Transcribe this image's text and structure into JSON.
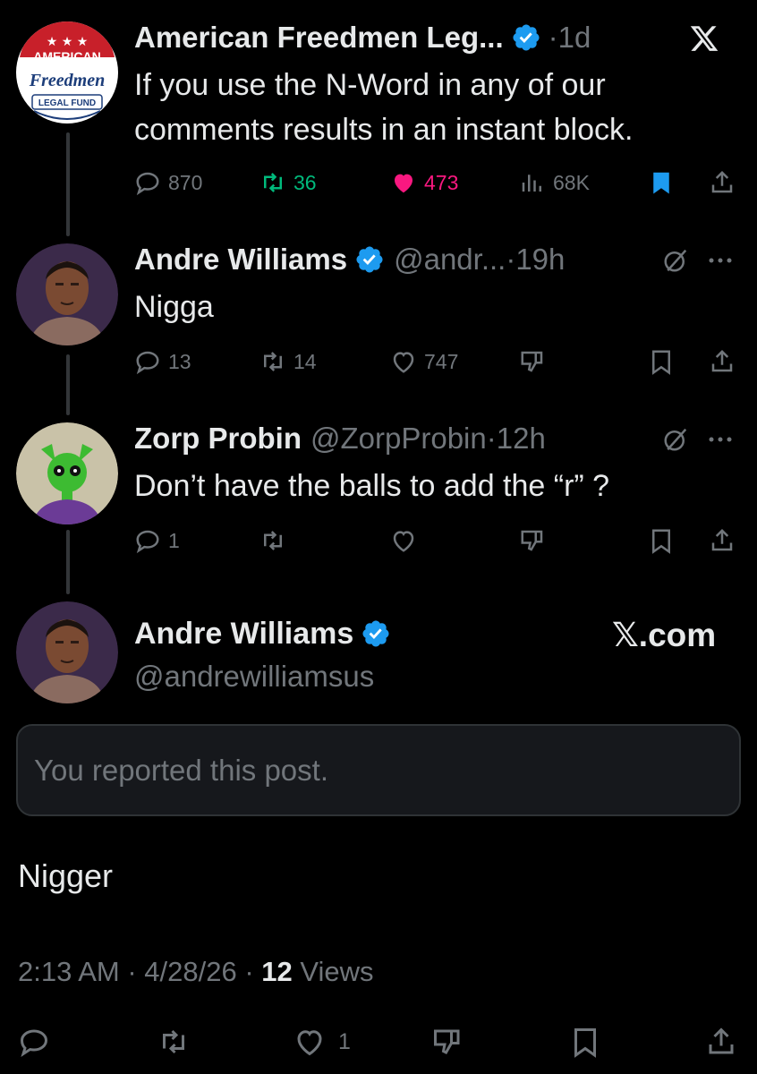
{
  "colors": {
    "background": "#000000",
    "text": "#e7e9ea",
    "muted": "#71767b",
    "verified": "#1d9bf0",
    "like": "#f91880",
    "repost": "#00ba7c",
    "border": "#2f3336"
  },
  "posts": [
    {
      "name": "American Freedmen Leg...",
      "handle": "",
      "dot": "·",
      "time": "1d",
      "text": "If you use the N-Word in any of our comments results in an instant block.",
      "replies": "870",
      "reposts": "36",
      "likes": "473",
      "views": "68K",
      "avatar": {
        "line1": "AMERICAN",
        "line2": "Freedmen",
        "line3": "LEGAL FUND"
      },
      "icons": {
        "top_right": "x-logo-icon"
      }
    },
    {
      "name": "Andre Williams",
      "handle": "@andr...",
      "dot": "·",
      "time": "19h",
      "text": "Nigga",
      "replies": "13",
      "reposts": "14",
      "likes": "747",
      "icons": {
        "top_right": "grok-icon",
        "more": "more-icon"
      }
    },
    {
      "name": "Zorp Probin",
      "handle": "@ZorpProbin",
      "dot": "·",
      "time": "12h",
      "text": "Don’t have the balls to add the “r” ?",
      "replies": "1",
      "icons": {
        "top_right": "grok-icon",
        "more": "more-icon"
      }
    }
  ],
  "main_post": {
    "name": "Andre Williams",
    "handle": "@andrewilliamsus",
    "site": "𝕏.com",
    "notice": "You reported this post.",
    "text": "Nigger",
    "time": "2:13 AM · 4/28/26 · ",
    "views_count": "12",
    "views_label": " Views",
    "likes": "1"
  }
}
